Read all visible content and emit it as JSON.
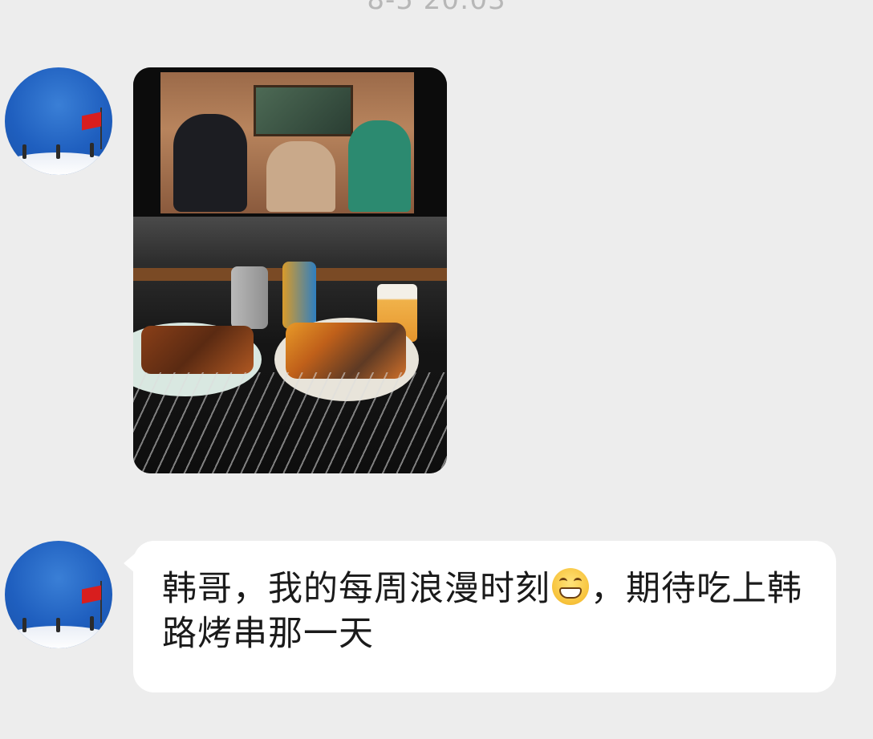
{
  "chat": {
    "timestamp": "8-5 20:03",
    "messages": [
      {
        "type": "image",
        "sender": "other",
        "avatar_icon": "avatar-flag-snow-icon"
      },
      {
        "type": "text",
        "sender": "other",
        "avatar_icon": "avatar-flag-snow-icon",
        "text_before_emoji": "韩哥，我的每周浪漫时刻",
        "emoji_icon": "grin-emoji-icon",
        "text_after_emoji": "，期待吃上韩路烤串那一天"
      }
    ]
  },
  "colors": {
    "background": "#ededed",
    "bubble": "#ffffff",
    "timestamp": "#b7b7b7",
    "text": "#1a1a1a"
  }
}
